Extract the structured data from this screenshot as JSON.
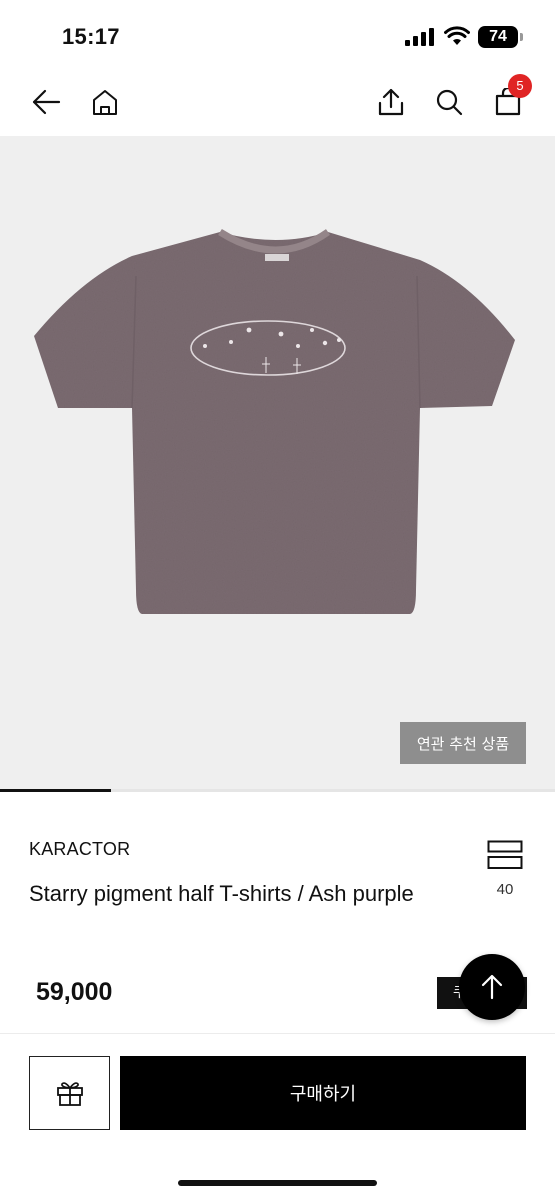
{
  "status_bar": {
    "time": "15:17",
    "battery": "74"
  },
  "nav": {
    "cart_count": "5"
  },
  "product": {
    "related_label": "연관 추천 상품",
    "image_progress": 0.2,
    "brand": "KARACTOR",
    "name": "Starry pigment half T-shirts / Ash purple",
    "price": "59,000",
    "like_count": "40",
    "coupon_label": "쿠",
    "shirt_color": "#7b6b71"
  },
  "bottom_bar": {
    "buy_label": "구매하기"
  },
  "icons": [
    "back-arrow-icon",
    "home-icon",
    "share-icon",
    "search-icon",
    "shopping-bag-icon",
    "bookmark-icon",
    "arrow-up-icon",
    "gift-icon"
  ]
}
